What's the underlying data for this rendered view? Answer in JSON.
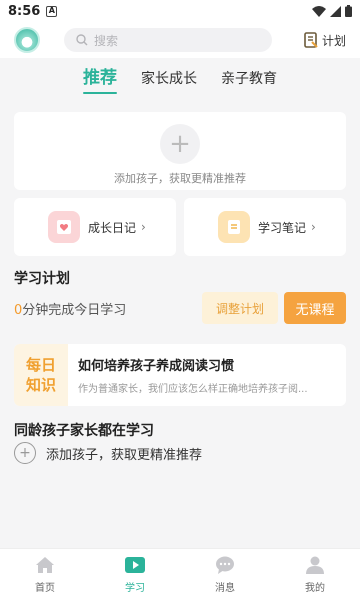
{
  "statusbar": {
    "time": "8:56",
    "badge": "A"
  },
  "topbar": {
    "search_placeholder": "搜索",
    "plan_label": "计划"
  },
  "tabs": [
    {
      "label": "推荐",
      "active": true
    },
    {
      "label": "家长成长",
      "active": false
    },
    {
      "label": "亲子教育",
      "active": false
    }
  ],
  "add_child": {
    "plus": "+",
    "hint": "添加孩子，获取更精准推荐"
  },
  "cards": {
    "diary": "成长日记",
    "notes": "学习笔记",
    "chevron": "›"
  },
  "study_plan": {
    "title": "学习计划",
    "minutes": "0",
    "text": "分钟完成今日学习",
    "adjust_label": "调整计划",
    "no_course_label": "无课程"
  },
  "daily_knowledge": {
    "badge_line1": "每日",
    "badge_line2": "知识",
    "title": "如何培养孩子养成阅读习惯",
    "desc": "作为普通家长，我们应该怎么样正确地培养孩子阅..."
  },
  "peers": {
    "title": "同龄孩子家长都在学习",
    "plus": "+",
    "add_label": "添加孩子，获取更精准推荐"
  },
  "nav": [
    {
      "label": "首页",
      "icon": "home-icon"
    },
    {
      "label": "学习",
      "icon": "play-icon",
      "active": true
    },
    {
      "label": "消息",
      "icon": "chat-icon"
    },
    {
      "label": "我的",
      "icon": "profile-icon"
    }
  ],
  "colors": {
    "accent": "#2bb39a",
    "orange": "#f5a340",
    "background": "#f5f5f6"
  }
}
